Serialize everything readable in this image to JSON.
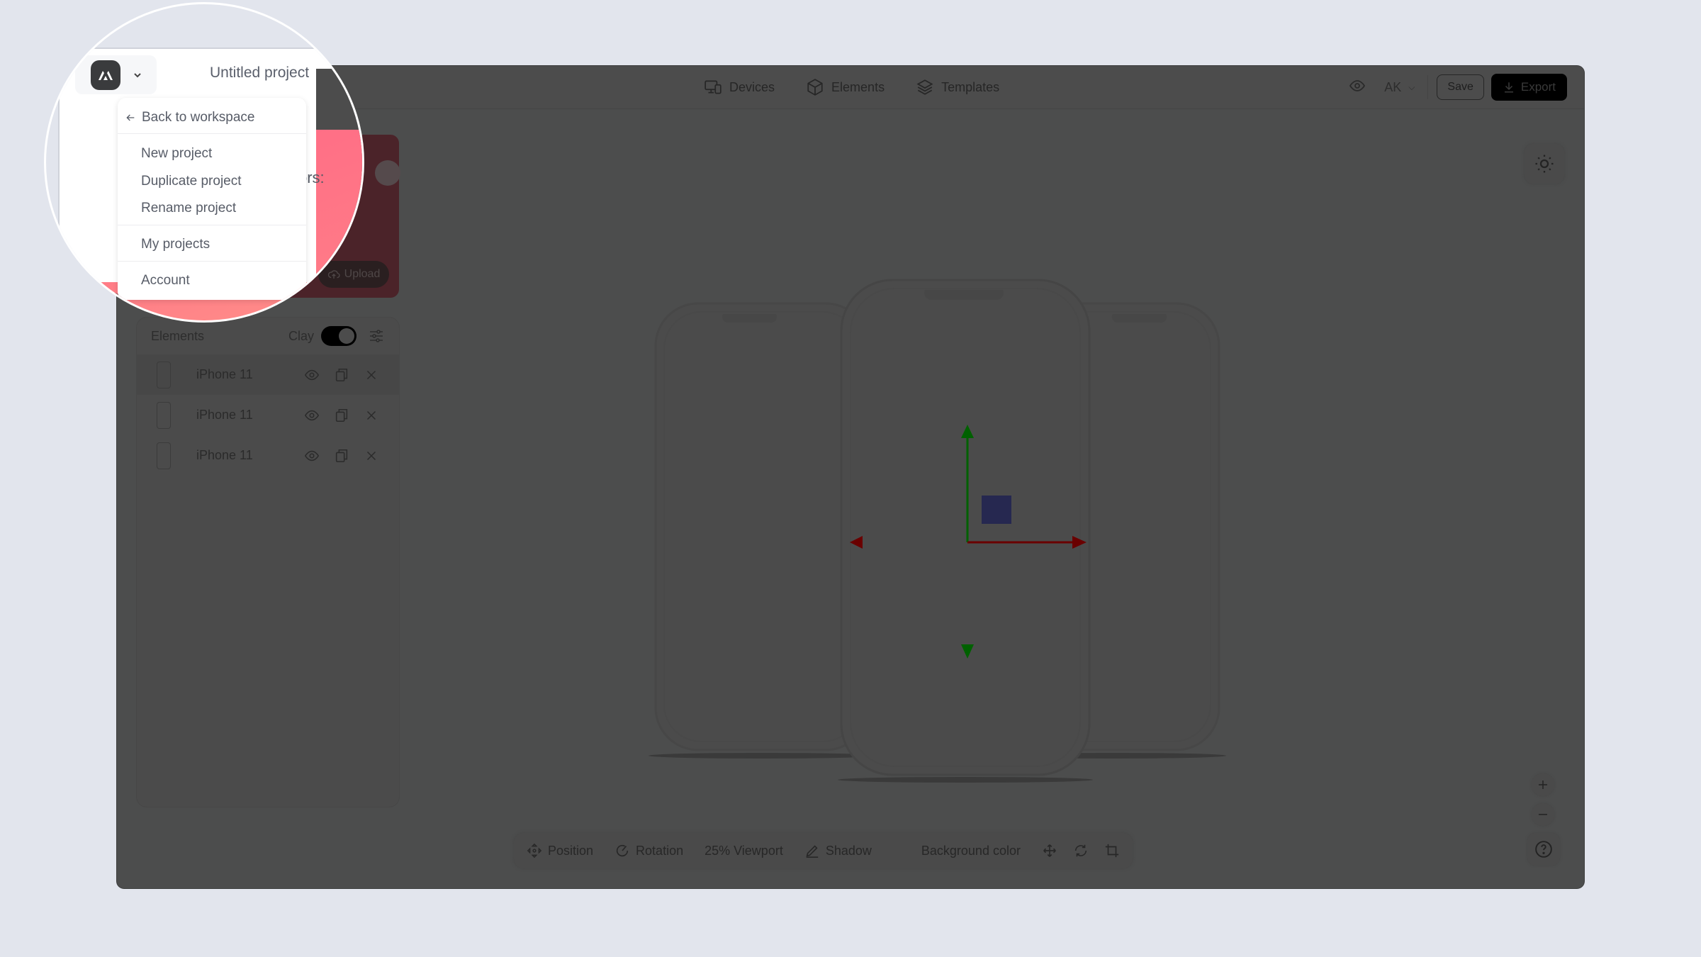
{
  "header": {
    "project_title": "Untitled project",
    "nav": [
      {
        "label": "Devices",
        "icon": "devices-icon"
      },
      {
        "label": "Elements",
        "icon": "cube-icon"
      },
      {
        "label": "Templates",
        "icon": "layers-icon"
      }
    ],
    "user_initials": "AK",
    "save_label": "Save",
    "export_label": "Export"
  },
  "project_menu": {
    "back_label": "Back to workspace",
    "items": [
      "New project",
      "Duplicate project",
      "Rename project",
      "My projects",
      "Account"
    ]
  },
  "left_card": {
    "partial_text": "ors:",
    "upload_label": "Upload",
    "accent_color": "#ff7186"
  },
  "elements_panel": {
    "title": "Elements",
    "clay_label": "Clay",
    "clay_enabled": true,
    "items": [
      {
        "name": "iPhone 11"
      },
      {
        "name": "iPhone 11"
      },
      {
        "name": "iPhone 11"
      }
    ]
  },
  "bottom_bar": {
    "position_label": "Position",
    "rotation_label": "Rotation",
    "viewport_label": "25% Viewport",
    "shadow_label": "Shadow",
    "background_label": "Background color"
  },
  "gizmo_colors": {
    "x_axis": "#6a0000",
    "y_axis": "#006100",
    "z_plane": "#262850"
  }
}
